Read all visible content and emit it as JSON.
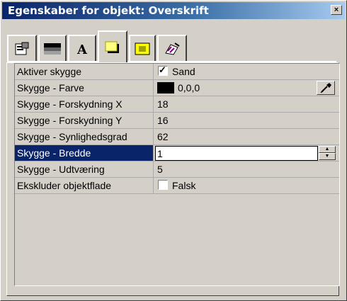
{
  "window": {
    "title": "Egenskaber for objekt: Overskrift",
    "close_glyph": "×"
  },
  "tabs": [
    {
      "icon": "properties-icon",
      "active": false
    },
    {
      "icon": "line-fill-icon",
      "active": false
    },
    {
      "icon": "text-format-icon",
      "active": false
    },
    {
      "icon": "shadow-icon",
      "active": true
    },
    {
      "icon": "highlight-box-icon",
      "active": false
    },
    {
      "icon": "effects-icon",
      "active": false
    }
  ],
  "rows": [
    {
      "label": "Aktiver skygge",
      "value": "Sand",
      "type": "checkbox",
      "checked": true
    },
    {
      "label": "Skygge - Farve",
      "value": "0,0,0",
      "type": "color",
      "color": "#000000"
    },
    {
      "label": "Skygge - Forskydning X",
      "value": "18"
    },
    {
      "label": "Skygge - Forskydning Y",
      "value": "16"
    },
    {
      "label": "Skygge - Synlighedsgrad",
      "value": "62"
    },
    {
      "label": "Skygge - Bredde",
      "value": "1",
      "type": "spin",
      "selected": true
    },
    {
      "label": "Skygge - Udtværing",
      "value": "5"
    },
    {
      "label": "Ekskluder objektflade",
      "value": "Falsk",
      "type": "checkbox",
      "checked": false
    }
  ],
  "colors": {
    "selection": "#0a246a",
    "title_start": "#0a246a",
    "title_end": "#a6caf0"
  }
}
